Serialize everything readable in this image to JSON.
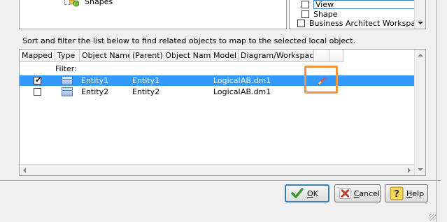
{
  "tree": {
    "node_label": "Shapes"
  },
  "checklist": {
    "items": [
      {
        "label": "View",
        "checked": false,
        "focused": true
      },
      {
        "label": "Shape",
        "checked": false
      },
      {
        "label": "Business Architect Workspace",
        "checked": false
      }
    ]
  },
  "instruction": "Sort and filter the list below to find related objects to map to the selected local object.",
  "grid": {
    "columns": [
      "Mapped",
      "Type",
      "Object Name",
      "(Parent) Object Name",
      "Model",
      "Diagram/Workspace",
      "",
      ""
    ],
    "filter_label": "Filter:",
    "rows": [
      {
        "mapped": true,
        "object_name": "Entity1",
        "parent_name": "Entity1",
        "model": "Logical",
        "diagram": "AB.dm1",
        "selected": true
      },
      {
        "mapped": false,
        "object_name": "Entity2",
        "parent_name": "Entity2",
        "model": "Logical",
        "diagram": "AB.dm1",
        "selected": false
      }
    ]
  },
  "buttons": {
    "ok": "OK",
    "cancel": "Cancel",
    "help": "Help"
  },
  "colors": {
    "selection": "#3399ff",
    "highlight": "#f0953a"
  }
}
